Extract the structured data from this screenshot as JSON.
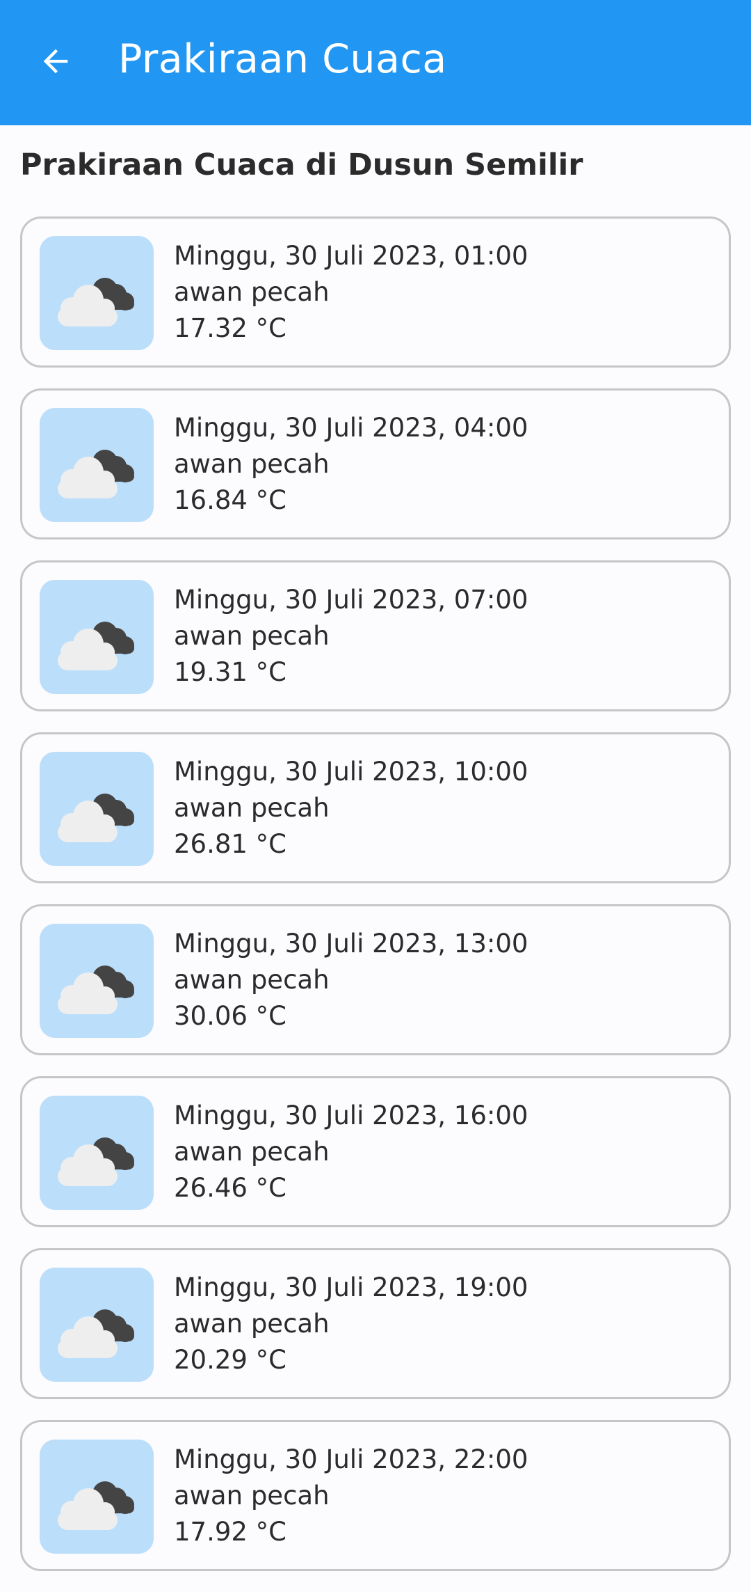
{
  "colors": {
    "app_bar": "#2196f3",
    "thumb_bg": "#bbdefb",
    "card_border": "#c6c6c6"
  },
  "app_bar": {
    "back_icon": "arrow-left-icon",
    "title": "Prakiraan Cuaca"
  },
  "subtitle": "Prakiraan Cuaca di Dusun Semilir",
  "forecast": [
    {
      "datetime": "Minggu, 30 Juli 2023, 01:00",
      "description": "awan pecah",
      "temperature": "17.32 °C",
      "icon": "broken-clouds-icon"
    },
    {
      "datetime": "Minggu, 30 Juli 2023, 04:00",
      "description": "awan pecah",
      "temperature": "16.84 °C",
      "icon": "broken-clouds-icon"
    },
    {
      "datetime": "Minggu, 30 Juli 2023, 07:00",
      "description": "awan pecah",
      "temperature": "19.31 °C",
      "icon": "broken-clouds-icon"
    },
    {
      "datetime": "Minggu, 30 Juli 2023, 10:00",
      "description": "awan pecah",
      "temperature": "26.81 °C",
      "icon": "broken-clouds-icon"
    },
    {
      "datetime": "Minggu, 30 Juli 2023, 13:00",
      "description": "awan pecah",
      "temperature": "30.06 °C",
      "icon": "broken-clouds-icon"
    },
    {
      "datetime": "Minggu, 30 Juli 2023, 16:00",
      "description": "awan pecah",
      "temperature": "26.46 °C",
      "icon": "broken-clouds-icon"
    },
    {
      "datetime": "Minggu, 30 Juli 2023, 19:00",
      "description": "awan pecah",
      "temperature": "20.29 °C",
      "icon": "broken-clouds-icon"
    },
    {
      "datetime": "Minggu, 30 Juli 2023, 22:00",
      "description": "awan pecah",
      "temperature": "17.92 °C",
      "icon": "broken-clouds-icon"
    }
  ]
}
